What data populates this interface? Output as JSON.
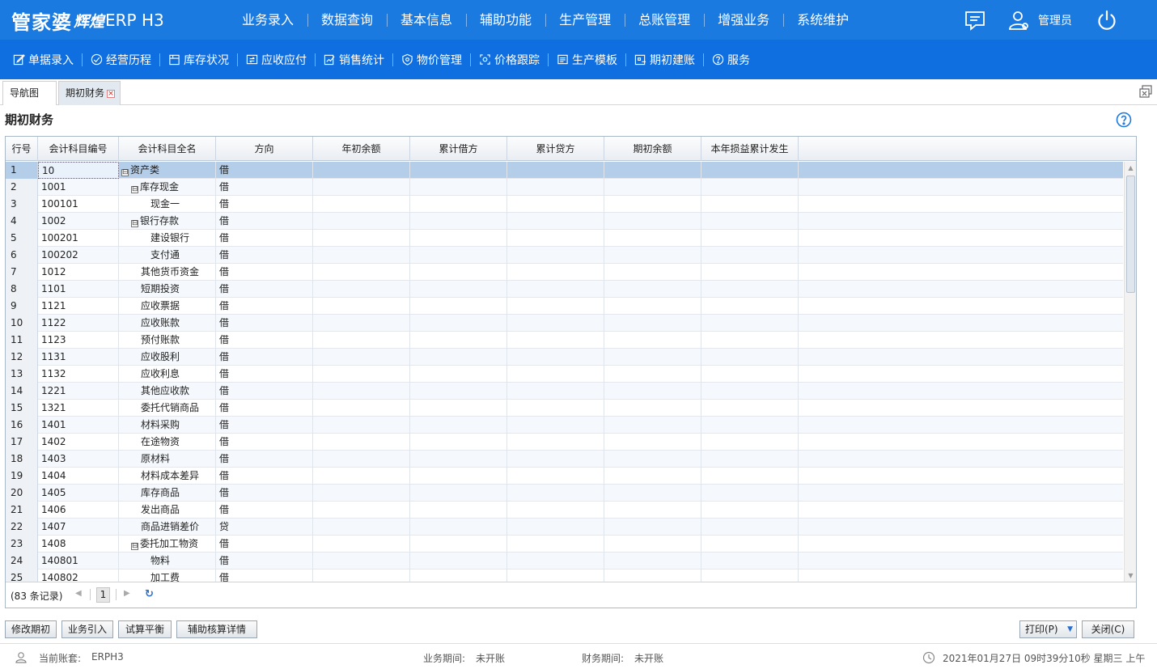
{
  "app": {
    "logo_main": "管家婆",
    "logo_sub": "辉煌",
    "logo_ver": "ERP H3"
  },
  "main_nav": [
    "业务录入",
    "数据查询",
    "基本信息",
    "辅助功能",
    "生产管理",
    "总账管理",
    "增强业务",
    "系统维护"
  ],
  "user": {
    "name": "管理员"
  },
  "sub_nav": [
    {
      "label": "单据录入",
      "icon": "edit-icon"
    },
    {
      "label": "经营历程",
      "icon": "check-circle-icon"
    },
    {
      "label": "库存状况",
      "icon": "inventory-icon"
    },
    {
      "label": "应收应付",
      "icon": "receivable-icon"
    },
    {
      "label": "销售统计",
      "icon": "sales-stats-icon"
    },
    {
      "label": "物价管理",
      "icon": "price-shield-icon"
    },
    {
      "label": "价格跟踪",
      "icon": "price-track-icon"
    },
    {
      "label": "生产模板",
      "icon": "template-icon"
    },
    {
      "label": "期初建账",
      "icon": "opening-account-icon"
    },
    {
      "label": "服务",
      "icon": "help-circle-icon"
    }
  ],
  "tabs": [
    {
      "label": "导航图"
    },
    {
      "label": "期初财务"
    }
  ],
  "page_title": "期初财务",
  "grid": {
    "columns": [
      "行号",
      "会计科目编号",
      "会计科目全名",
      "方向",
      "年初余额",
      "累计借方",
      "累计贷方",
      "期初余额",
      "本年损益累计发生"
    ],
    "rows": [
      {
        "n": "1",
        "code": "10",
        "name": "资产类",
        "dir": "借",
        "level": 0,
        "tree": true
      },
      {
        "n": "2",
        "code": "1001",
        "name": "库存现金",
        "dir": "借",
        "level": 1,
        "tree": true
      },
      {
        "n": "3",
        "code": "100101",
        "name": "现金一",
        "dir": "借",
        "level": 2,
        "tree": false
      },
      {
        "n": "4",
        "code": "1002",
        "name": "银行存款",
        "dir": "借",
        "level": 1,
        "tree": true
      },
      {
        "n": "5",
        "code": "100201",
        "name": "建设银行",
        "dir": "借",
        "level": 2,
        "tree": false
      },
      {
        "n": "6",
        "code": "100202",
        "name": "支付通",
        "dir": "借",
        "level": 2,
        "tree": false
      },
      {
        "n": "7",
        "code": "1012",
        "name": "其他货币资金",
        "dir": "借",
        "level": 1,
        "tree": false
      },
      {
        "n": "8",
        "code": "1101",
        "name": "短期投资",
        "dir": "借",
        "level": 1,
        "tree": false
      },
      {
        "n": "9",
        "code": "1121",
        "name": "应收票据",
        "dir": "借",
        "level": 1,
        "tree": false
      },
      {
        "n": "10",
        "code": "1122",
        "name": "应收账款",
        "dir": "借",
        "level": 1,
        "tree": false
      },
      {
        "n": "11",
        "code": "1123",
        "name": "预付账款",
        "dir": "借",
        "level": 1,
        "tree": false
      },
      {
        "n": "12",
        "code": "1131",
        "name": "应收股利",
        "dir": "借",
        "level": 1,
        "tree": false
      },
      {
        "n": "13",
        "code": "1132",
        "name": "应收利息",
        "dir": "借",
        "level": 1,
        "tree": false
      },
      {
        "n": "14",
        "code": "1221",
        "name": "其他应收款",
        "dir": "借",
        "level": 1,
        "tree": false
      },
      {
        "n": "15",
        "code": "1321",
        "name": "委托代销商品",
        "dir": "借",
        "level": 1,
        "tree": false
      },
      {
        "n": "16",
        "code": "1401",
        "name": "材料采购",
        "dir": "借",
        "level": 1,
        "tree": false
      },
      {
        "n": "17",
        "code": "1402",
        "name": "在途物资",
        "dir": "借",
        "level": 1,
        "tree": false
      },
      {
        "n": "18",
        "code": "1403",
        "name": "原材料",
        "dir": "借",
        "level": 1,
        "tree": false
      },
      {
        "n": "19",
        "code": "1404",
        "name": "材料成本差异",
        "dir": "借",
        "level": 1,
        "tree": false
      },
      {
        "n": "20",
        "code": "1405",
        "name": "库存商品",
        "dir": "借",
        "level": 1,
        "tree": false
      },
      {
        "n": "21",
        "code": "1406",
        "name": "发出商品",
        "dir": "借",
        "level": 1,
        "tree": false
      },
      {
        "n": "22",
        "code": "1407",
        "name": "商品进销差价",
        "dir": "贷",
        "level": 1,
        "tree": false
      },
      {
        "n": "23",
        "code": "1408",
        "name": "委托加工物资",
        "dir": "借",
        "level": 1,
        "tree": true
      },
      {
        "n": "24",
        "code": "140801",
        "name": "物料",
        "dir": "借",
        "level": 2,
        "tree": false
      },
      {
        "n": "25",
        "code": "140802",
        "name": "加工费",
        "dir": "借",
        "level": 2,
        "tree": false
      }
    ],
    "tree_toggle": "⊟",
    "selected_row": 0
  },
  "pager": {
    "total": "(83 条记录)",
    "current_page": "1"
  },
  "buttons": {
    "modify": "修改期初",
    "import": "业务引入",
    "trial": "试算平衡",
    "aux": "辅助核算详情",
    "print": "打印(P)",
    "close": "关闭(C)"
  },
  "status": {
    "account_label": "当前账套:",
    "account_value": "ERPH3",
    "biz_label": "业务期间:",
    "biz_value": "未开账",
    "fin_label": "财务期间:",
    "fin_value": "未开账",
    "datetime": "2021年01月27日 09时39分10秒 星期三 上午"
  },
  "colors": {
    "topbar": "#1a7ae0",
    "subnav": "#0f6fe0",
    "selected_row": "#b4cde8"
  }
}
